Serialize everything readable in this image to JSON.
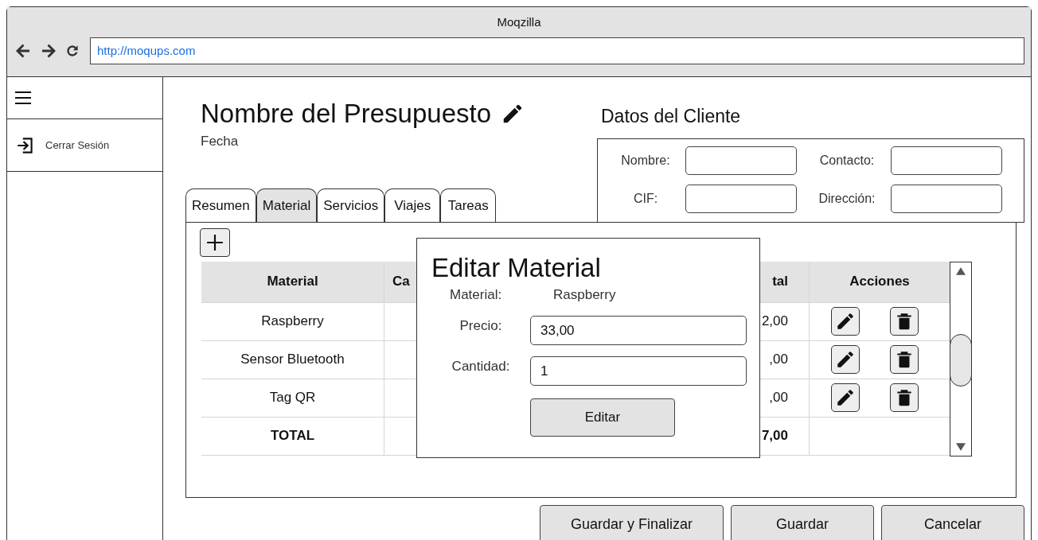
{
  "window": {
    "title": "Moqzilla",
    "url": "http://moqups.com"
  },
  "sidebar": {
    "logout_label": "Cerrar Sesión"
  },
  "page": {
    "title": "Nombre del Presupuesto",
    "date": "Fecha"
  },
  "client": {
    "heading": "Datos del Cliente",
    "fields": [
      {
        "label": "Nombre:"
      },
      {
        "label": "Contacto:"
      },
      {
        "label": "CIF:"
      },
      {
        "label": "Dirección:"
      }
    ]
  },
  "tabs": [
    {
      "label": "Resumen",
      "selected": false
    },
    {
      "label": "Material",
      "selected": true
    },
    {
      "label": "Servicios",
      "selected": false
    },
    {
      "label": "Viajes",
      "selected": false
    },
    {
      "label": "Tareas",
      "selected": false
    }
  ],
  "table": {
    "columns": [
      "Material",
      "Ca",
      "tal",
      "Acciones"
    ],
    "rows": [
      {
        "kind": "item",
        "material": "Raspberry",
        "column_3": "2,00"
      },
      {
        "kind": "item",
        "material": "Sensor Bluetooth",
        "column_3": ",00"
      },
      {
        "kind": "item",
        "material": "Tag QR",
        "column_3": ",00"
      },
      {
        "kind": "total",
        "material": "TOTAL",
        "column_3": "7,00"
      }
    ]
  },
  "dialog": {
    "title": "Editar Material",
    "material_label": "Material:",
    "material_value": "Raspberry",
    "fields": [
      {
        "label": "Precio:",
        "value": "33,00"
      },
      {
        "label": "Cantidad:",
        "value": "1"
      }
    ],
    "button": "Editar"
  },
  "buttons": [
    "Guardar y Finalizar",
    "Guardar",
    "Cancelar"
  ]
}
